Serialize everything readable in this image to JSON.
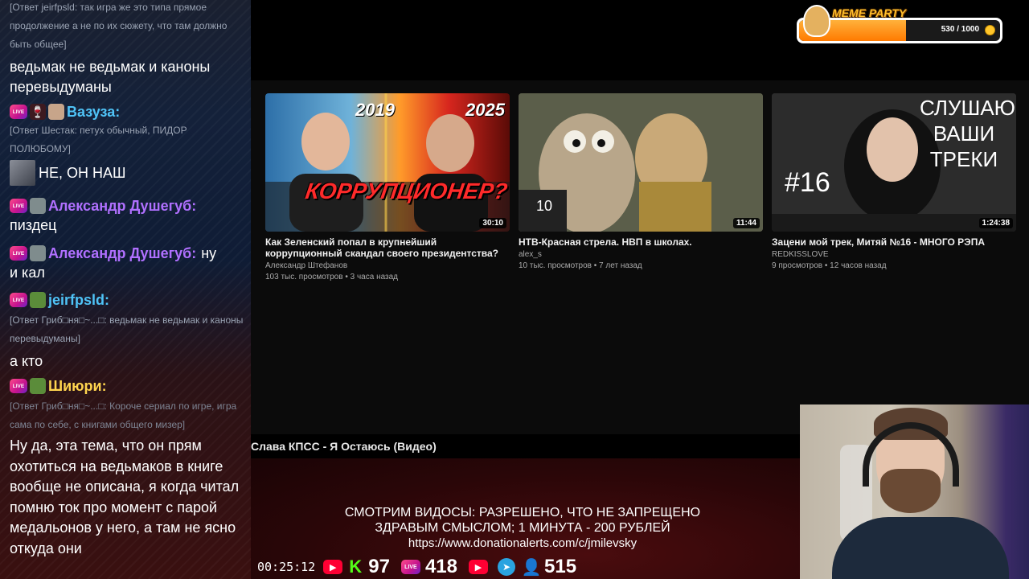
{
  "chat": {
    "messages": [
      {
        "reply": "[Ответ jeirfpsld: так игра же это типа прямое продолжение а не по их сюжету, что там должно быть общее]",
        "text": "ведьмак не ведьмак и каноны перевыдуманы"
      },
      {
        "user": "Вазуза:",
        "user_color": "#4fc3f7",
        "reply": "[Ответ Шестак: петух обычный, ПИДОР ПОЛЮБОМУ]",
        "text": "НЕ, ОН НАШ"
      },
      {
        "user": "Александр Душегуб:",
        "user_color": "#b070ff",
        "text": "пиздец"
      },
      {
        "user": "Александр Душегуб:",
        "user_color": "#b070ff",
        "text_inline": "ну",
        "text": "и кал"
      },
      {
        "user": "jeirfpsld:",
        "user_color": "#4fc3f7",
        "reply": "[Ответ Гриб□ня□~...□: ведьмак не ведьмак и каноны перевыдуманы]",
        "text": "а кто"
      },
      {
        "user": "Шиюри:",
        "user_color": "#ffd54f",
        "reply": "[Ответ Гриб□ня□~...□: Короче сериал по игре, игра сама по себе, с книгами общего мизер]",
        "text": "Ну да, эта тема, что он прям охотиться на ведьмаков в книге вообще не описана, я когда читал помню ток про момент с парой медальонов у него, а там не ясно откуда они"
      }
    ],
    "live_label": "LIVE"
  },
  "videos": [
    {
      "title": "Как Зеленский попал в крупнейший коррупционный скандал своего президентства?",
      "channel": "Александр Штефанов",
      "meta": "103 тыс. просмотров • 3 часа назад",
      "duration": "30:10",
      "overlay_left": "2019",
      "overlay_right": "2025",
      "overlay_text": "КОРРУПЦИОНЕР?"
    },
    {
      "title": "НТВ-Красная стрела. НВП в школах.",
      "channel": "alex_s",
      "meta": "10 тыс. просмотров • 7 лет назад",
      "duration": "11:44",
      "overlay_text": "10"
    },
    {
      "title": "Зацени мой трек, Митяй №16 - МНОГО РЭПА",
      "channel": "REDKISSLOVE",
      "meta": "9 просмотров • 12 часов назад",
      "duration": "1:24:38",
      "overlay_text": "СЛУШАЮ ВАШИ ТРЕКИ",
      "overlay_num": "#16"
    }
  ],
  "now_playing": "Слава КПСС - Я Остаюсь (Видео)",
  "notice": {
    "line1": "СМОТРИМ ВИДОСЫ: РАЗРЕШЕНО, ЧТО НЕ ЗАПРЕЩЕНО",
    "line2": "ЗДРАВЫМ СМЫСЛОМ; 1 МИНУТА - 200 РУБЛЕЙ",
    "url": "https://www.donationalerts.com/c/jmilevsky"
  },
  "status": {
    "timer": "00:25:12",
    "kick_count": "97",
    "vk_count": "418",
    "viewers": "515",
    "kick_glyph": "K",
    "vk_label": "LIVE",
    "yt_glyph": "▶",
    "tg_glyph": "➤",
    "user_glyph": "👤"
  },
  "meme_party": {
    "label": "MEME PARTY",
    "count": "530 / 1000",
    "progress": 0.53
  }
}
